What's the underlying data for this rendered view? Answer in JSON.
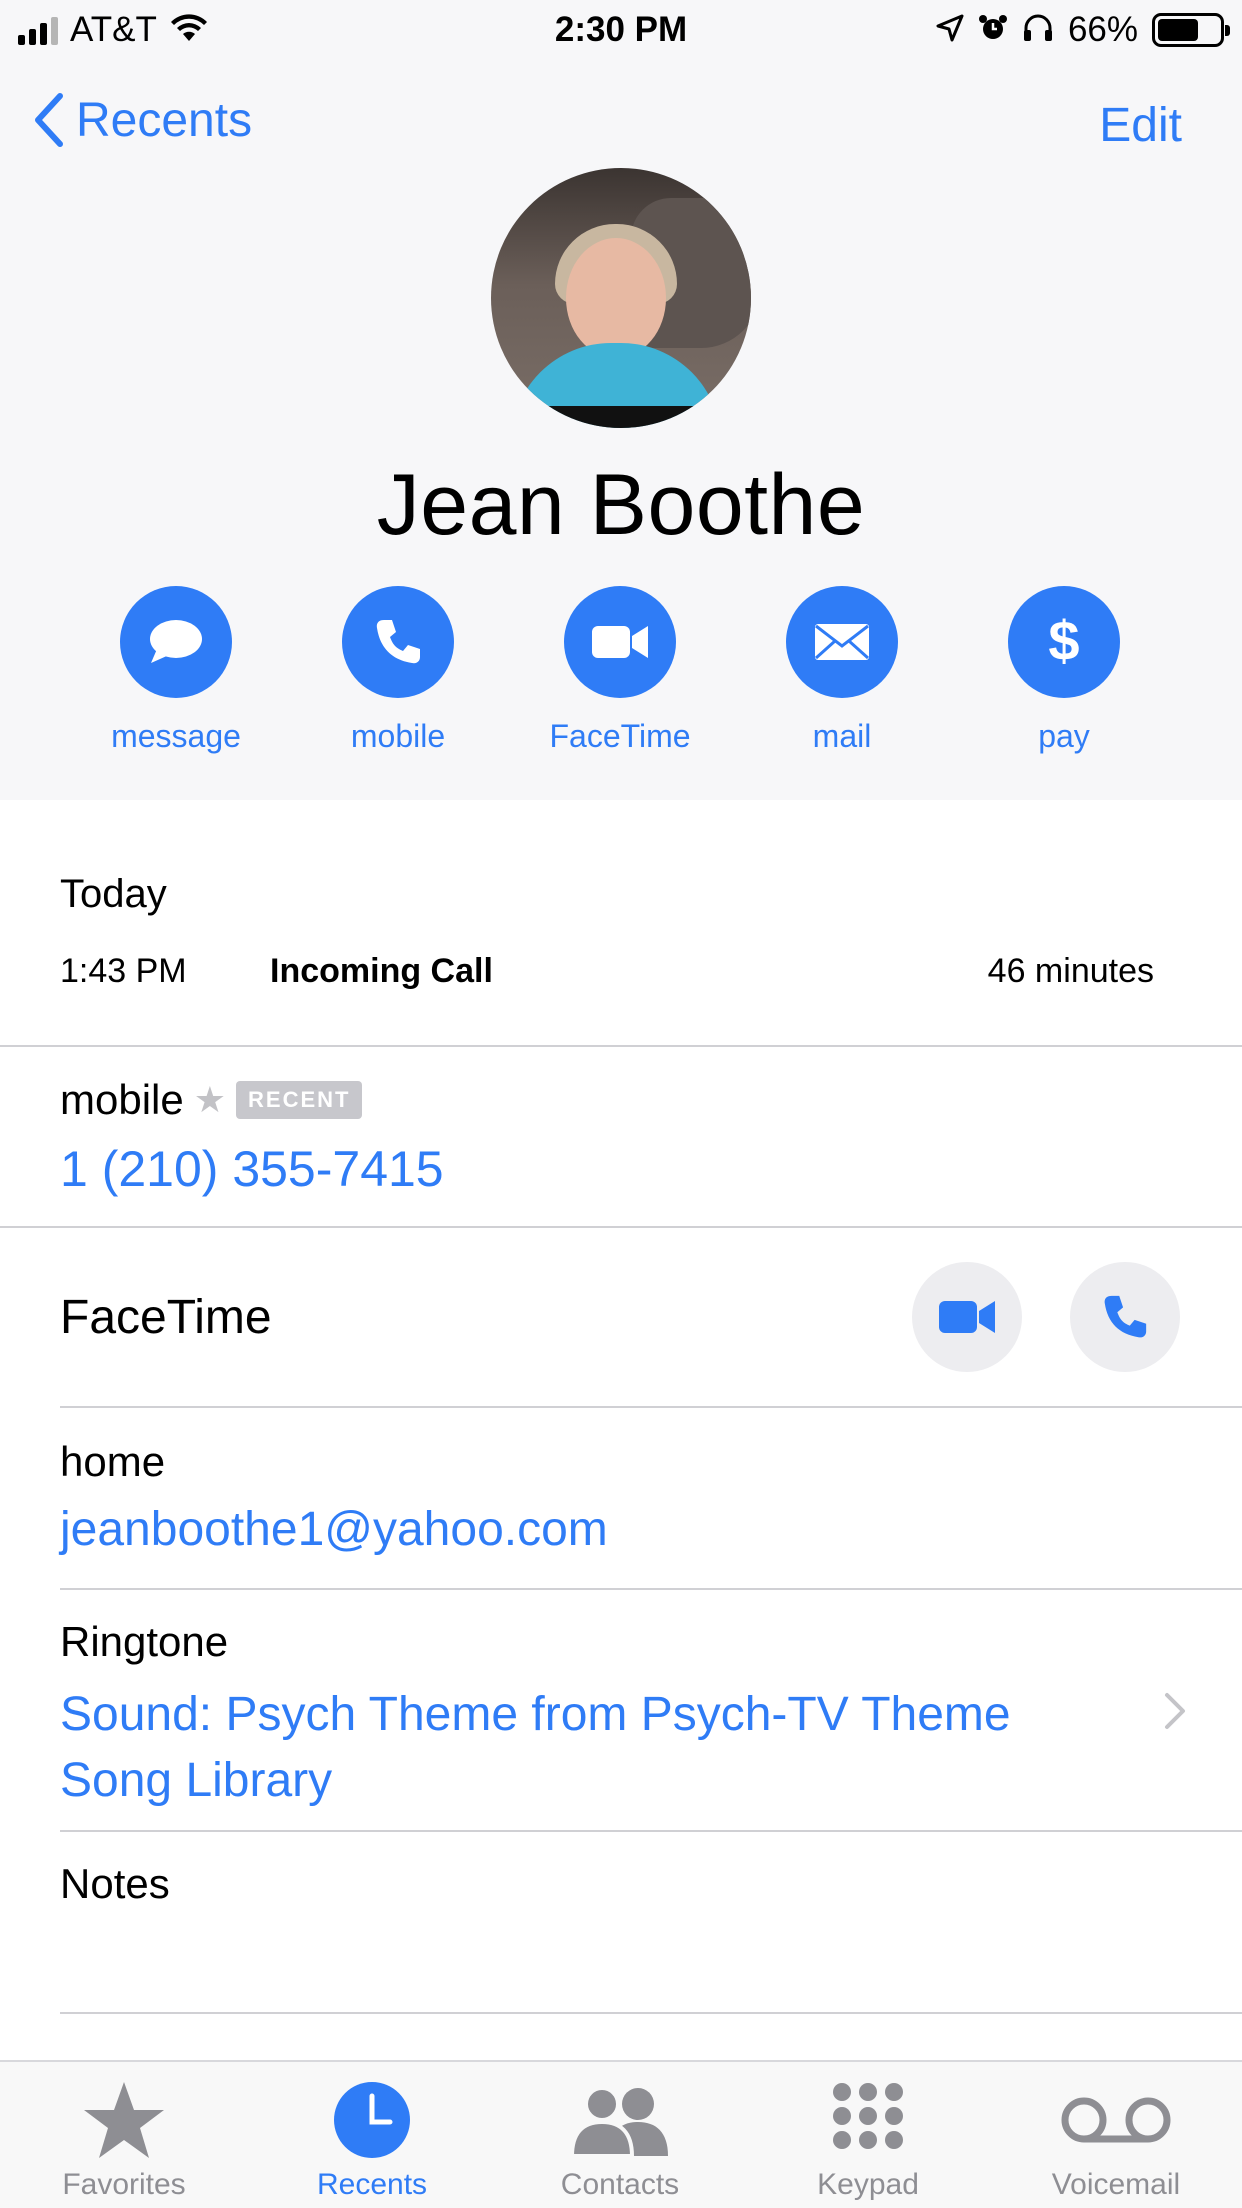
{
  "status_bar": {
    "carrier": "AT&T",
    "time": "2:30 PM",
    "battery_percent": "66%",
    "battery_level": 0.66,
    "icons": [
      "signal-icon",
      "wifi-icon",
      "location-icon",
      "alarm-icon",
      "headphones-icon",
      "battery-icon"
    ]
  },
  "nav": {
    "back_label": "Recents",
    "edit_label": "Edit"
  },
  "contact": {
    "name": "Jean Boothe"
  },
  "actions": [
    {
      "label": "message",
      "icon": "message-bubble-icon"
    },
    {
      "label": "mobile",
      "icon": "phone-icon"
    },
    {
      "label": "FaceTime",
      "icon": "video-camera-icon"
    },
    {
      "label": "mail",
      "icon": "envelope-icon"
    },
    {
      "label": "pay",
      "icon": "dollar-icon"
    }
  ],
  "recent_call": {
    "day": "Today",
    "time": "1:43 PM",
    "type": "Incoming Call",
    "duration": "46 minutes"
  },
  "phone": {
    "label": "mobile",
    "badge": "RECENT",
    "number": "1 (210) 355-7415"
  },
  "facetime": {
    "label": "FaceTime"
  },
  "email": {
    "label": "home",
    "value": "jeanboothe1@yahoo.com"
  },
  "ringtone": {
    "label": "Ringtone",
    "value": "Sound: Psych  Theme from Psych-TV Theme Song Library"
  },
  "notes": {
    "label": "Notes"
  },
  "tabbar": {
    "active": "Recents",
    "tabs": [
      {
        "label": "Favorites",
        "icon": "star-icon"
      },
      {
        "label": "Recents",
        "icon": "clock-icon"
      },
      {
        "label": "Contacts",
        "icon": "contacts-icon"
      },
      {
        "label": "Keypad",
        "icon": "keypad-icon"
      },
      {
        "label": "Voicemail",
        "icon": "voicemail-icon"
      }
    ]
  },
  "colors": {
    "accent": "#2f7cf6",
    "header_background": "#f7f7f9",
    "separator": "#d0d0d4",
    "inactive_tab": "#8e8e93"
  }
}
